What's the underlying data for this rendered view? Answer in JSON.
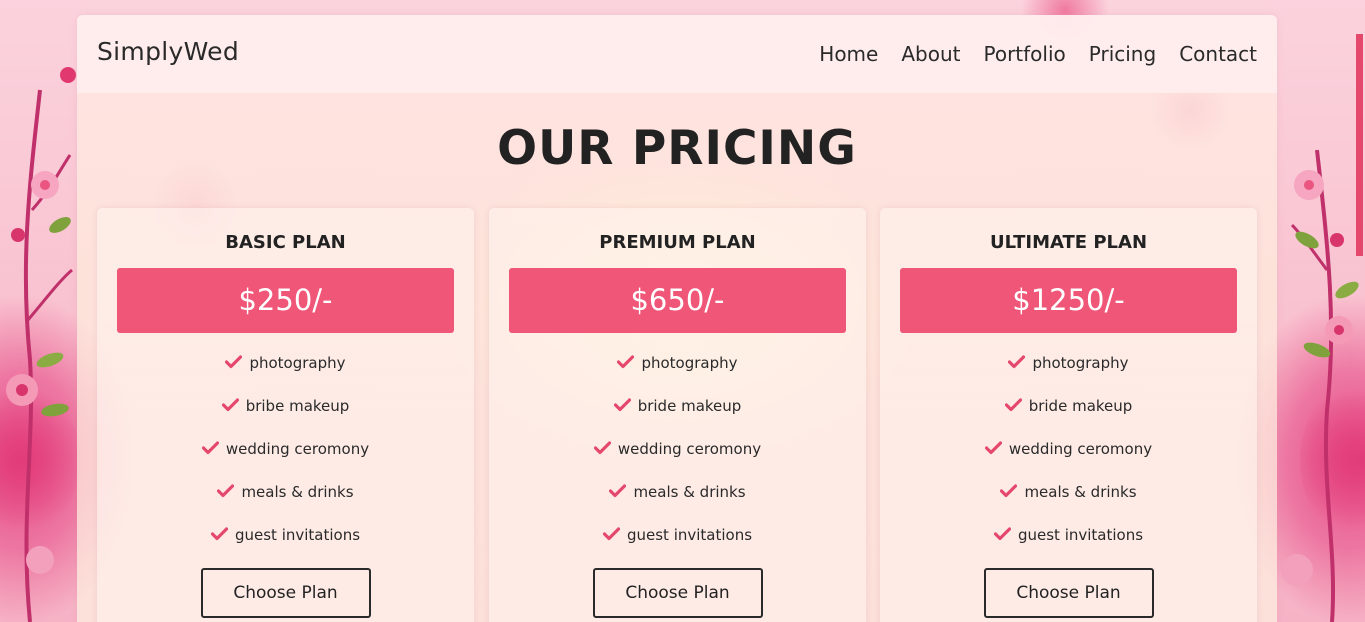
{
  "brand": "SimplyWed",
  "nav": {
    "items": [
      {
        "label": "Home"
      },
      {
        "label": "About"
      },
      {
        "label": "Portfolio"
      },
      {
        "label": "Pricing"
      },
      {
        "label": "Contact"
      }
    ]
  },
  "heading": "OUR PRICING",
  "plans": [
    {
      "title": "BASIC PLAN",
      "price": "$250/-",
      "features": [
        "photography",
        "bribe makeup",
        "wedding ceromony",
        "meals & drinks",
        "guest invitations"
      ],
      "button": "Choose Plan"
    },
    {
      "title": "PREMIUM PLAN",
      "price": "$650/-",
      "features": [
        "photography",
        "bride makeup",
        "wedding ceromony",
        "meals & drinks",
        "guest invitations"
      ],
      "button": "Choose Plan"
    },
    {
      "title": "ULTIMATE PLAN",
      "price": "$1250/-",
      "features": [
        "photography",
        "bride makeup",
        "wedding ceromony",
        "meals & drinks",
        "guest invitations"
      ],
      "button": "Choose Plan"
    }
  ],
  "colors": {
    "accent": "#ef5677",
    "text": "#222222",
    "check": "#e5486d"
  },
  "icons": {
    "feature": "check-icon",
    "decoration": "cherry-blossom-icon"
  }
}
